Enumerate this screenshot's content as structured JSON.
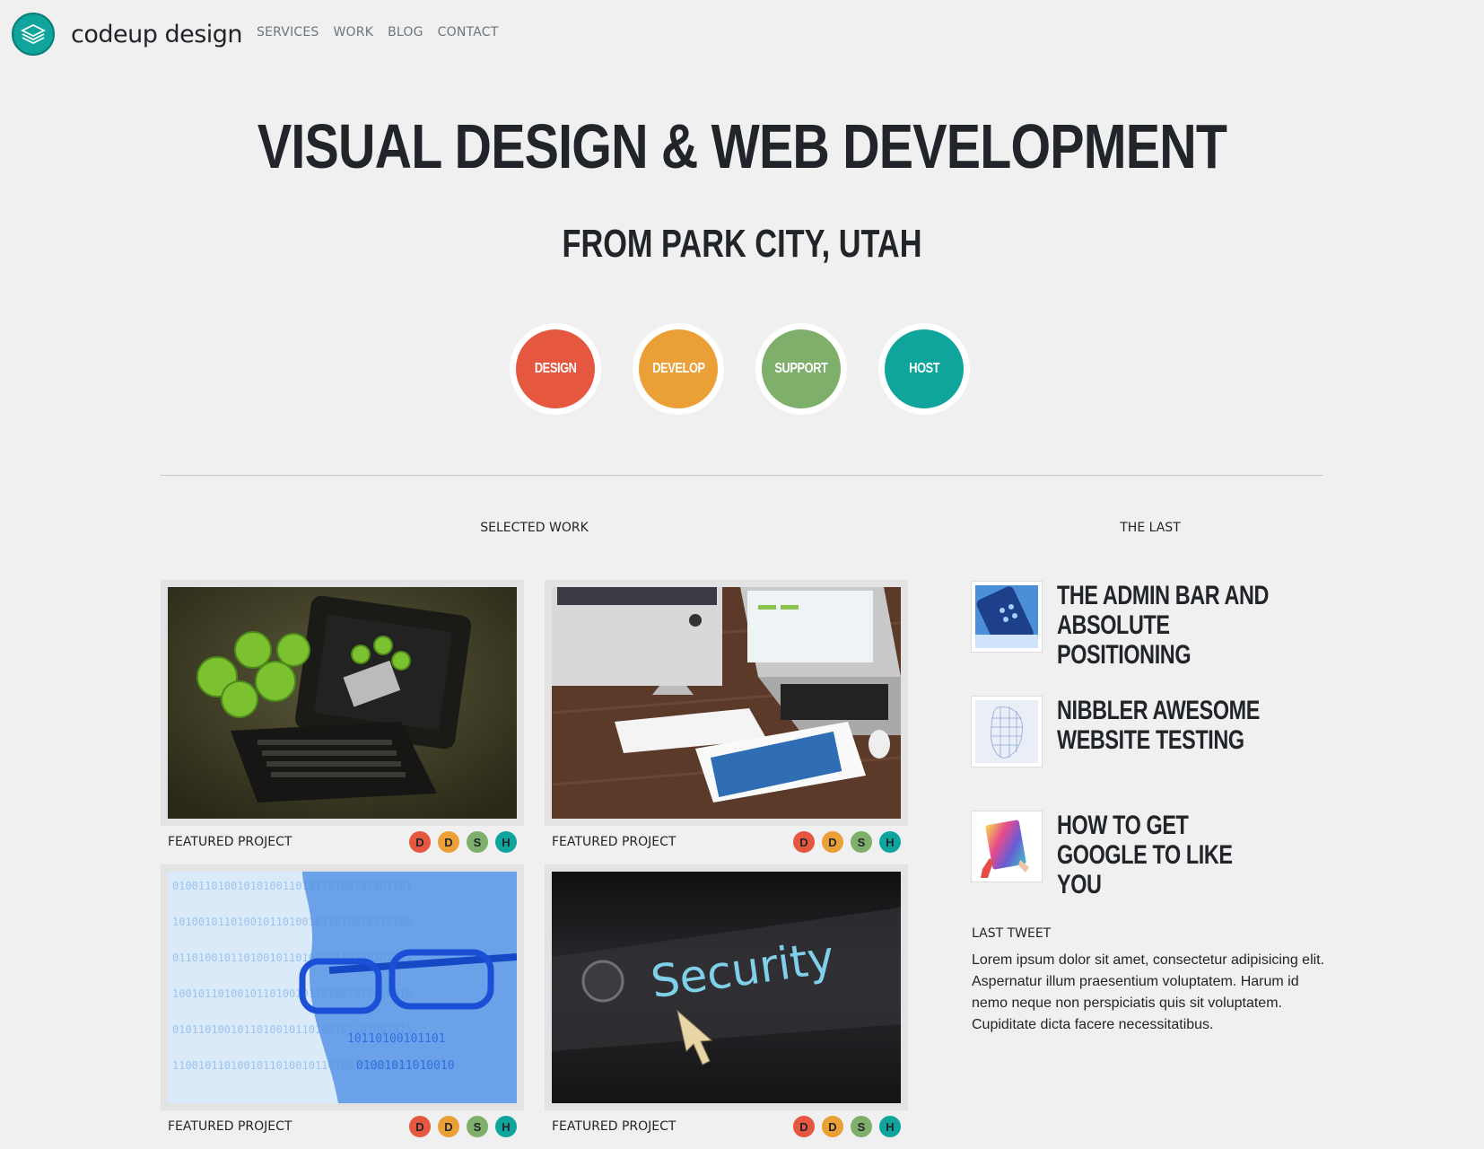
{
  "brand": {
    "name": "codeup design",
    "logo_icon": "stacked-layers-icon",
    "logo_color": "#0fa49c"
  },
  "nav": {
    "links": [
      "SERVICES",
      "WORK",
      "BLOG",
      "CONTACT"
    ]
  },
  "hero": {
    "title": "VISUAL DESIGN & WEB DEVELOPMENT",
    "subtitle": "FROM PARK CITY, UTAH"
  },
  "services": [
    {
      "label": "DESIGN",
      "color": "#e5573f"
    },
    {
      "label": "DEVELOP",
      "color": "#eb9f37"
    },
    {
      "label": "SUPPORT",
      "color": "#7fb06b"
    },
    {
      "label": "HOST",
      "color": "#0fa49c"
    }
  ],
  "work": {
    "heading": "SELECTED WORK",
    "items": [
      {
        "label": "FEATURED PROJECT",
        "image_icon": "tablet-apples-photo"
      },
      {
        "label": "FEATURED PROJECT",
        "image_icon": "desk-devices-photo"
      },
      {
        "label": "FEATURED PROJECT",
        "image_icon": "binary-face-photo"
      },
      {
        "label": "FEATURED PROJECT",
        "image_icon": "security-screen-photo"
      }
    ],
    "tags": [
      {
        "letter": "D",
        "color": "#e5573f"
      },
      {
        "letter": "D",
        "color": "#eb9f37"
      },
      {
        "letter": "S",
        "color": "#7fb06b"
      },
      {
        "letter": "H",
        "color": "#0fa49c"
      }
    ]
  },
  "sidebar": {
    "heading": "THE LAST",
    "posts": [
      {
        "title": "THE ADMIN BAR AND ABSOLUTE POSITIONING",
        "thumb_icon": "phone-apps-thumb"
      },
      {
        "title": "NIBBLER AWESOME WEBSITE TESTING",
        "thumb_icon": "wireframe-face-thumb"
      },
      {
        "title": "HOW TO GET GOOGLE TO LIKE YOU",
        "thumb_icon": "colorful-tablet-thumb"
      }
    ],
    "tweet_label": "LAST TWEET",
    "tweet_text": "Lorem ipsum dolor sit amet, consectetur adipisicing elit. Aspernatur illum praesentium voluptatem. Harum id nemo neque non perspiciatis quis sit voluptatem. Cupiditate dicta facere necessitatibus."
  }
}
